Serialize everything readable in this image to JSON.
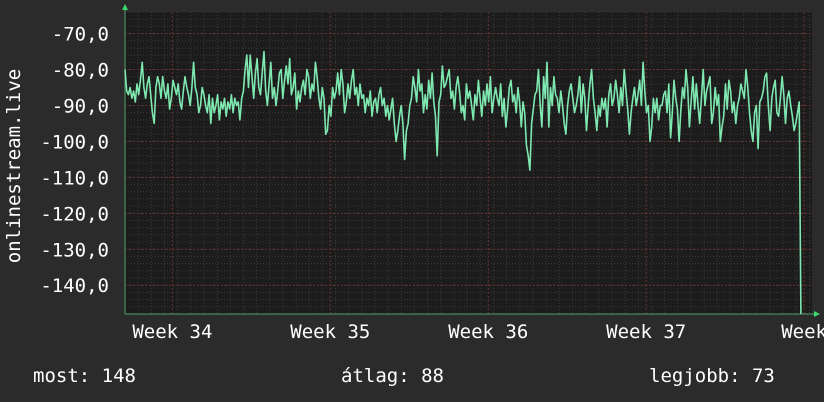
{
  "chart_data": {
    "type": "line",
    "ylabel": "onlinestream.live",
    "ylim": [
      -148,
      -64
    ],
    "y_ticks": [
      -70,
      -80,
      -90,
      -100,
      -110,
      -120,
      -130,
      -140
    ],
    "y_tick_labels": [
      "-70,0",
      "-80,0",
      "-90,0",
      "-100,0",
      "-110,0",
      "-120,0",
      "-130,0",
      "-140,0"
    ],
    "x_ticks": [
      {
        "label": "Week 34",
        "pos": 1.0
      },
      {
        "label": "Week 35",
        "pos": 2.0
      },
      {
        "label": "Week 36",
        "pos": 3.0
      },
      {
        "label": "Week 37",
        "pos": 4.0
      },
      {
        "label": "Week",
        "pos": 5.0
      }
    ],
    "xlim": [
      0.7,
      5.05
    ],
    "grid": true,
    "line_color": "#7ee8b0",
    "series": [
      {
        "values": [
          -80,
          -86,
          -87,
          -85,
          -88,
          -86,
          -89,
          -84,
          -87,
          -83,
          -78,
          -85,
          -88,
          -84,
          -82,
          -87,
          -92,
          -95,
          -85,
          -82,
          -84,
          -88,
          -82,
          -86,
          -88,
          -84,
          -91,
          -88,
          -83,
          -85,
          -87,
          -84,
          -89,
          -91,
          -86,
          -82,
          -85,
          -87,
          -90,
          -85,
          -78,
          -85,
          -87,
          -92,
          -90,
          -85,
          -87,
          -90,
          -92,
          -87,
          -95,
          -88,
          -92,
          -90,
          -87,
          -94,
          -89,
          -91,
          -88,
          -93,
          -89,
          -91,
          -87,
          -92,
          -88,
          -90,
          -89,
          -94,
          -88,
          -86,
          -80,
          -76,
          -85,
          -76,
          -82,
          -88,
          -81,
          -77,
          -85,
          -87,
          -81,
          -75,
          -86,
          -90,
          -84,
          -78,
          -88,
          -85,
          -90,
          -86,
          -81,
          -80,
          -88,
          -83,
          -79,
          -84,
          -77,
          -87,
          -85,
          -81,
          -91,
          -86,
          -89,
          -85,
          -83,
          -87,
          -80,
          -82,
          -88,
          -84,
          -86,
          -78,
          -82,
          -88,
          -91,
          -85,
          -88,
          -98,
          -97,
          -90,
          -93,
          -85,
          -88,
          -86,
          -81,
          -87,
          -80,
          -84,
          -92,
          -89,
          -84,
          -88,
          -83,
          -80,
          -87,
          -85,
          -90,
          -84,
          -88,
          -87,
          -92,
          -88,
          -90,
          -86,
          -93,
          -89,
          -88,
          -92,
          -87,
          -85,
          -90,
          -88,
          -93,
          -90,
          -94,
          -91,
          -88,
          -95,
          -100,
          -97,
          -93,
          -90,
          -95,
          -105,
          -97,
          -95,
          -90,
          -88,
          -82,
          -85,
          -89,
          -80,
          -86,
          -84,
          -92,
          -87,
          -91,
          -83,
          -88,
          -81,
          -89,
          -93,
          -104,
          -89,
          -87,
          -79,
          -85,
          -84,
          -82,
          -80,
          -88,
          -86,
          -91,
          -85,
          -82,
          -86,
          -92,
          -90,
          -94,
          -84,
          -88,
          -86,
          -90,
          -94,
          -87,
          -90,
          -83,
          -88,
          -93,
          -86,
          -90,
          -84,
          -89,
          -82,
          -92,
          -88,
          -85,
          -88,
          -90,
          -84,
          -93,
          -88,
          -96,
          -91,
          -85,
          -83,
          -89,
          -87,
          -92,
          -85,
          -89,
          -96,
          -89,
          -92,
          -101,
          -104,
          -108,
          -95,
          -91,
          -87,
          -86,
          -80,
          -90,
          -96,
          -82,
          -88,
          -78,
          -96,
          -85,
          -90,
          -82,
          -87,
          -88,
          -92,
          -86,
          -90,
          -95,
          -98,
          -90,
          -86,
          -84,
          -88,
          -92,
          -90,
          -87,
          -82,
          -92,
          -84,
          -88,
          -97,
          -90,
          -84,
          -80,
          -88,
          -92,
          -97,
          -90,
          -93,
          -88,
          -91,
          -88,
          -96,
          -87,
          -84,
          -90,
          -88,
          -83,
          -87,
          -92,
          -85,
          -90,
          -80,
          -86,
          -91,
          -98,
          -92,
          -88,
          -85,
          -90,
          -87,
          -83,
          -90,
          -78,
          -86,
          -92,
          -90,
          -100,
          -96,
          -88,
          -92,
          -88,
          -94,
          -90,
          -90,
          -87,
          -86,
          -92,
          -84,
          -99,
          -92,
          -83,
          -88,
          -91,
          -100,
          -91,
          -85,
          -88,
          -80,
          -85,
          -96,
          -89,
          -82,
          -91,
          -84,
          -90,
          -95,
          -88,
          -80,
          -90,
          -86,
          -84,
          -82,
          -95,
          -92,
          -85,
          -90,
          -87,
          -100,
          -96,
          -93,
          -84,
          -91,
          -83,
          -86,
          -92,
          -89,
          -95,
          -90,
          -88,
          -84,
          -86,
          -88,
          -80,
          -85,
          -92,
          -97,
          -100,
          -92,
          -90,
          -102,
          -89,
          -88,
          -86,
          -82,
          -81,
          -90,
          -97,
          -88,
          -85,
          -83,
          -92,
          -93,
          -88,
          -82,
          -87,
          -95,
          -88,
          -86,
          -90,
          -93,
          -97,
          -95,
          -92,
          -89,
          -148
        ]
      }
    ]
  },
  "footer": {
    "now_label": "most: 148",
    "avg_label": "átlag: 88",
    "best_label": "legjobb: 73"
  }
}
